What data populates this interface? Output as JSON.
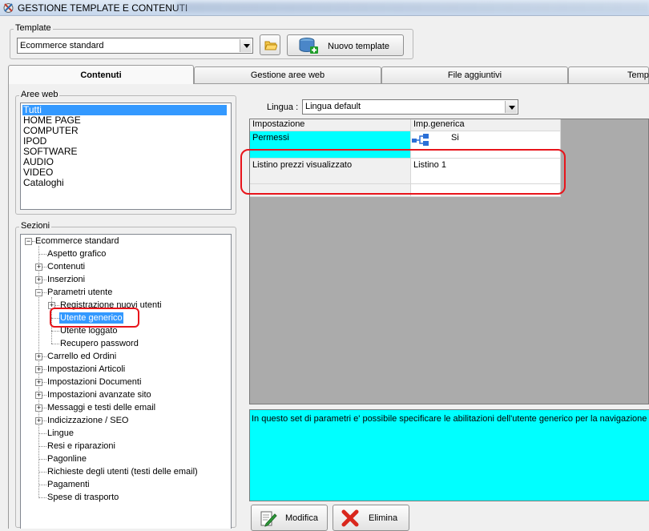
{
  "window": {
    "title": "GESTIONE TEMPLATE E CONTENUTI"
  },
  "template_group": {
    "legend": "Template",
    "selected": "Ecommerce standard",
    "new_button": "Nuovo template"
  },
  "tabs": [
    {
      "label": "Contenuti",
      "active": true
    },
    {
      "label": "Gestione aree web",
      "active": false
    },
    {
      "label": "File aggiuntivi",
      "active": false
    },
    {
      "label": "Temp",
      "active": false
    }
  ],
  "aree_web": {
    "legend": "Aree web",
    "items": [
      "Tutti",
      "HOME PAGE",
      "COMPUTER",
      "IPOD",
      "SOFTWARE",
      "AUDIO",
      "VIDEO",
      "Cataloghi"
    ],
    "selected_index": 0
  },
  "sezioni": {
    "legend": "Sezioni",
    "root": "Ecommerce standard",
    "nodes": [
      "Aspetto grafico",
      "Contenuti",
      "Inserzioni",
      "Parametri utente",
      "Registrazione nuovi utenti",
      "Utente generico",
      "Utente loggato",
      "Recupero password",
      "Carrello ed Ordini",
      "Impostazioni Articoli",
      "Impostazioni Documenti",
      "Impostazioni avanzate sito",
      "Messaggi e testi delle email",
      "Indicizzazione / SEO",
      "Lingue",
      "Resi e riparazioni",
      "Pagonline",
      "Richieste degli utenti (testi delle email)",
      "Pagamenti",
      "Spese di trasporto"
    ]
  },
  "lingua": {
    "label": "Lingua :",
    "selected": "Lingua default"
  },
  "grid": {
    "headers": [
      "Impostazione",
      "Imp.generica"
    ],
    "rows": [
      {
        "setting": "Permessi",
        "value": "Si"
      },
      {
        "setting": "Listino prezzi visualizzato",
        "value": "Listino 1"
      }
    ]
  },
  "description": "In questo set di parametri e' possibile specificare le abilitazioni dell'utente generico per la navigazione su",
  "actions": {
    "modify": "Modifica",
    "delete": "Elimina"
  },
  "colors": {
    "highlight": "#3399ff",
    "cyan": "#00ffff",
    "annotation": "#e8141b"
  }
}
